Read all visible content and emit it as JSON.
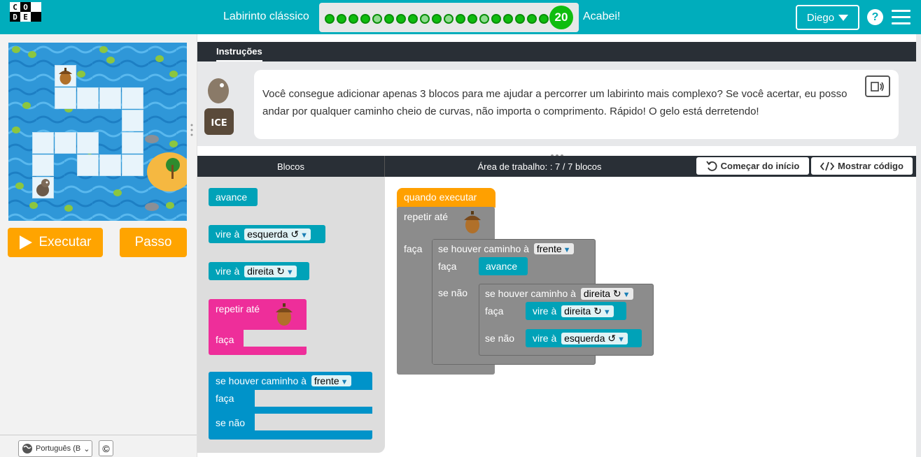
{
  "header": {
    "logo_letters": [
      "C",
      "O",
      "",
      "D",
      "E",
      ""
    ],
    "level_title": "Labirinto clássico",
    "current_level": "20",
    "finish_label": "Acabei!",
    "user_name": "Diego",
    "help_label": "?"
  },
  "maze": {
    "run_button": "Executar",
    "step_button": "Passo"
  },
  "footer": {
    "language": "Português (B",
    "copyright": "©"
  },
  "instructions": {
    "tab_label": "Instruções",
    "text": "Você consegue adicionar apenas 3 blocos para me ajudar a percorrer um labirinto mais complexo? Se você acertar, eu posso andar por qualquer caminho cheio de curvas, não importa o comprimento. Rápido! O gelo está derretendo!"
  },
  "workspace_header": {
    "blocks_title": "Blocos",
    "workspace_title": "Área de trabalho: : 7 / 7 blocos",
    "restart_button": "Começar do início",
    "show_code_button": "Mostrar código"
  },
  "toolbox": {
    "move_forward": "avance",
    "turn_label": "vire à",
    "left": "esquerda ↺",
    "right": "direita ↻",
    "repeat_until": "repetir até",
    "do_label": "faça",
    "if_path": "se houver caminho à",
    "forward": "frente",
    "else_label": "se não"
  },
  "program": {
    "when_run": "quando executar",
    "repeat_until": "repetir até",
    "do_label": "faça",
    "if_path": "se houver caminho à",
    "forward": "frente",
    "move_forward": "avance",
    "else_label": "se não",
    "right": "direita ↻",
    "left": "esquerda ↺",
    "turn_label": "vire à"
  },
  "colors": {
    "header": "#00adbc",
    "run": "#ffa400",
    "action_block": "#00a2b8",
    "loop_block": "#ee2e9a",
    "logic_block": "#0093c9",
    "program_block": "#8c8c8c",
    "event_block": "#ffa000",
    "progress_dot": "#0fbd0f"
  }
}
